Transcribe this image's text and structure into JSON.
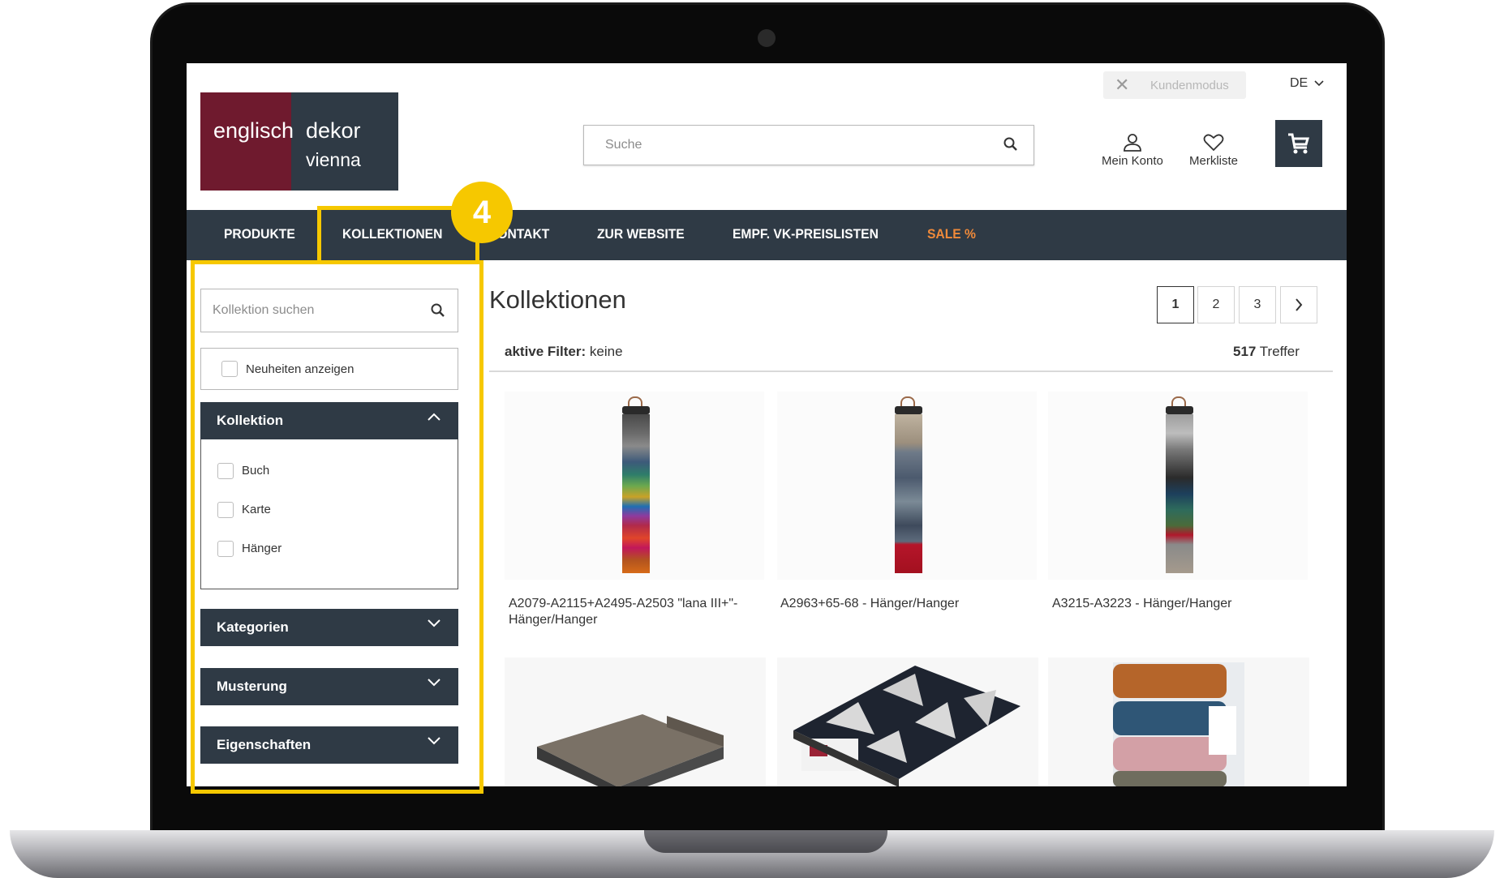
{
  "logo": {
    "word1": "englisch",
    "word2": "dekor",
    "word3": "vienna"
  },
  "header": {
    "kundenmodus_label": "Kundenmodus",
    "lang": "DE",
    "search_placeholder": "Suche",
    "account_label": "Mein Konto",
    "wishlist_label": "Merkliste"
  },
  "nav": {
    "items": [
      "PRODUKTE",
      "KOLLEKTIONEN",
      "KONTAKT",
      "ZUR WEBSITE",
      "EMPF. VK-PREISLISTEN",
      "SALE %"
    ]
  },
  "sidebar": {
    "search_placeholder": "Kollektion suchen",
    "new_checkbox_label": "Neuheiten anzeigen",
    "kollektion_title": "Kollektion",
    "kollektion_options": [
      "Buch",
      "Karte",
      "Hänger"
    ],
    "kategorien_title": "Kategorien",
    "musterung_title": "Musterung",
    "eigenschaften_title": "Eigenschaften"
  },
  "main": {
    "title": "Kollektionen",
    "pages": [
      "1",
      "2",
      "3"
    ],
    "active_filter_label": "aktive Filter:",
    "active_filter_value": "keine",
    "hits_count": "517",
    "hits_label": "Treffer",
    "products": [
      {
        "caption": "A2079-A2115+A2495-A2503 \"lana III+\"- Hänger/Hanger"
      },
      {
        "caption": "A2963+65-68 - Hänger/Hanger"
      },
      {
        "caption": "A3215-A3223 - Hänger/Hanger"
      }
    ]
  },
  "annotation": {
    "step_number": "4",
    "highlight_color": "#f6c800"
  },
  "colors": {
    "brand_dark": "#2f3a45",
    "brand_red": "#6f1a2e",
    "sale": "#f08a3a"
  }
}
